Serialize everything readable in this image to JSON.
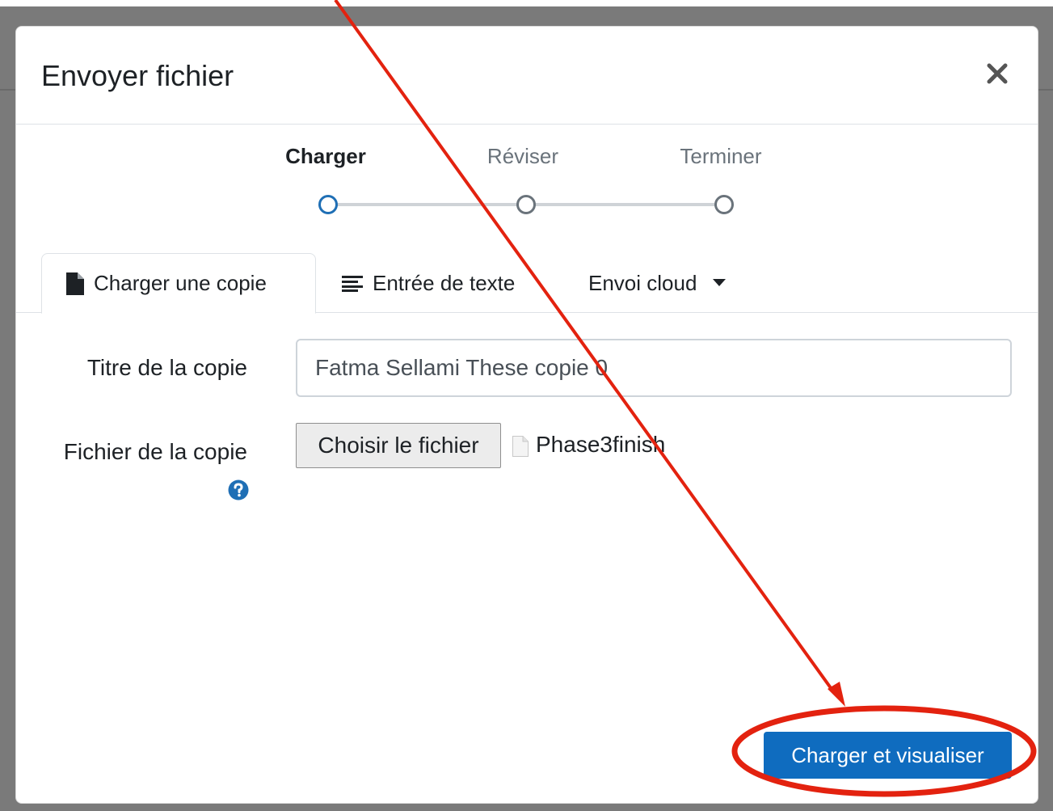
{
  "modal": {
    "title": "Envoyer fichier",
    "close_icon": "close-icon"
  },
  "steps": [
    {
      "label": "Charger",
      "active": true
    },
    {
      "label": "Réviser",
      "active": false
    },
    {
      "label": "Terminer",
      "active": false
    }
  ],
  "tabs": [
    {
      "label": "Charger une copie",
      "icon": "file-icon",
      "active": true
    },
    {
      "label": "Entrée de texte",
      "icon": "text-lines-icon",
      "active": false
    },
    {
      "label": "Envoi cloud",
      "icon": "caret-down-icon",
      "active": false
    }
  ],
  "form": {
    "title_label": "Titre de la copie",
    "title_value": "Fatma Sellami These copie 0",
    "file_label": "Fichier de la copie",
    "file_button": "Choisir le fichier",
    "file_name": "Phase3finish",
    "help_icon": "question-circle-icon"
  },
  "actions": {
    "submit_label": "Charger et visualiser"
  },
  "annotation": {
    "color": "#e3220f",
    "shapes": [
      "arrow",
      "ellipse"
    ]
  },
  "colors": {
    "primary": "#0f6cbf",
    "active_step": "#1f6fb5"
  }
}
